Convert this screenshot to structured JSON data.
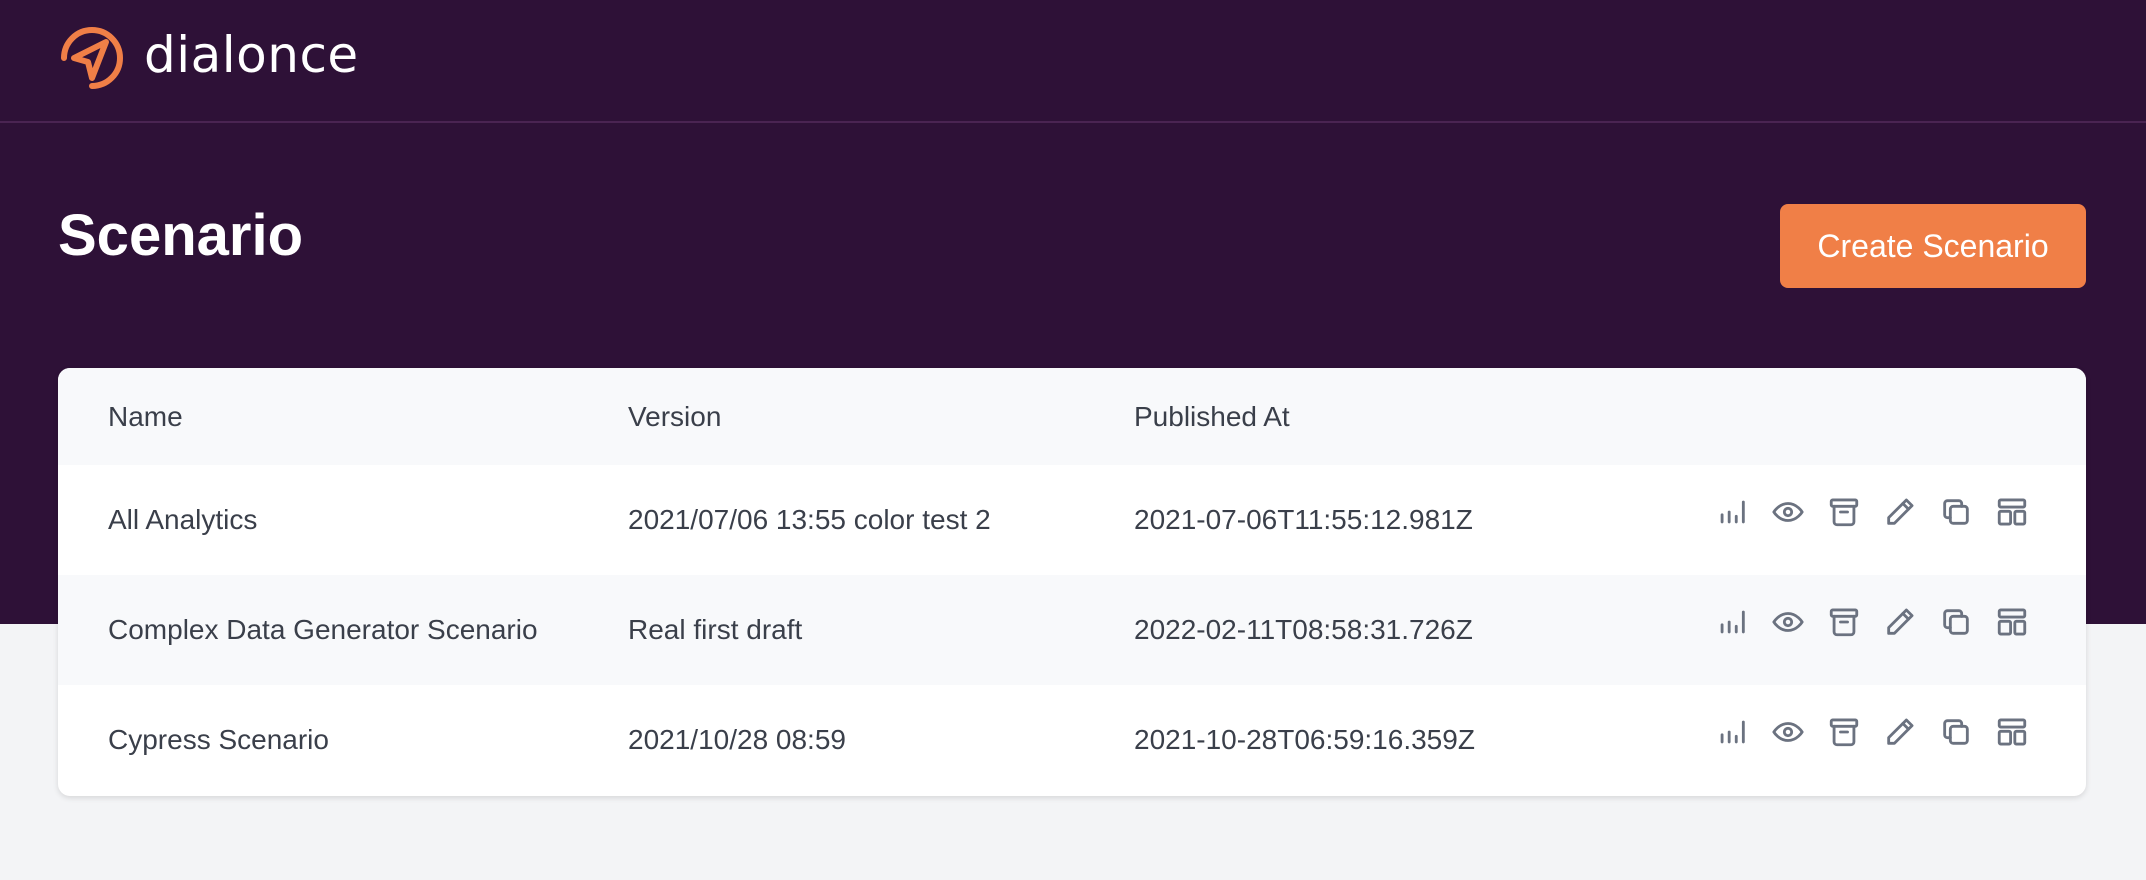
{
  "brand": {
    "name": "dialonce",
    "accent": "#f07f47",
    "header_bg": "#2e1137"
  },
  "page": {
    "title": "Scenario",
    "create_label": "Create Scenario"
  },
  "table": {
    "columns": [
      "Name",
      "Version",
      "Published At"
    ],
    "rows": [
      {
        "name": "All Analytics",
        "version": "2021/07/06 13:55 color test 2",
        "published_at": "2021-07-06T11:55:12.981Z"
      },
      {
        "name": "Complex Data Generator Scenario",
        "version": "Real first draft",
        "published_at": "2022-02-11T08:58:31.726Z"
      },
      {
        "name": "Cypress Scenario",
        "version": "2021/10/28 08:59",
        "published_at": "2021-10-28T06:59:16.359Z"
      }
    ],
    "row_actions": [
      "analytics-icon",
      "view-icon",
      "archive-icon",
      "edit-icon",
      "duplicate-icon",
      "layout-icon"
    ]
  }
}
